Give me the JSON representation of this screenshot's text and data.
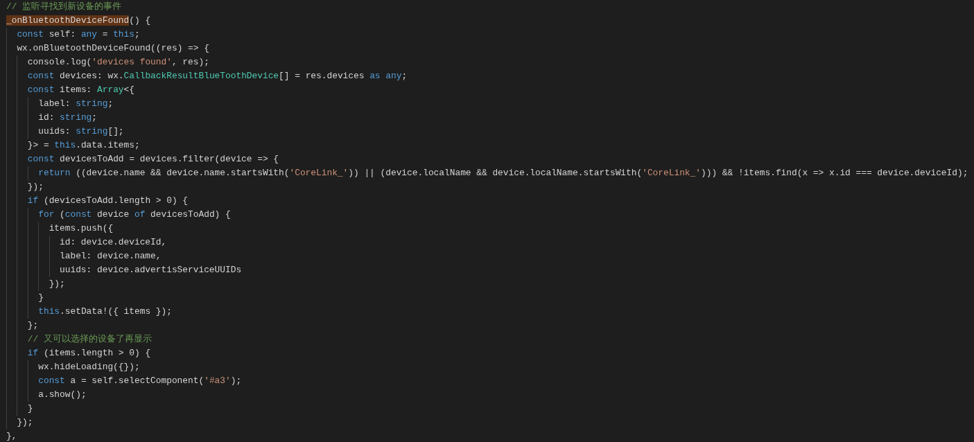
{
  "editor": {
    "lines": [
      {
        "tokens": [
          {
            "text": "// 监听寻找到新设备的事件",
            "kind": "comment"
          }
        ]
      },
      {
        "tokens": [
          {
            "text": "_onBluetoothDeviceFound",
            "kind": "plain",
            "highlighted": true
          },
          {
            "text": "() {",
            "kind": "plain"
          }
        ]
      },
      {
        "tokens": [
          {
            "text": "  const",
            "kind": "keyword"
          },
          {
            "text": " self: ",
            "kind": "plain"
          },
          {
            "text": "any",
            "kind": "keyword"
          },
          {
            "text": " = ",
            "kind": "plain"
          },
          {
            "text": "this",
            "kind": "keyword"
          },
          {
            "text": ";",
            "kind": "plain"
          }
        ]
      },
      {
        "tokens": [
          {
            "text": "  wx.onBluetoothDeviceFound((res) => {",
            "kind": "plain"
          }
        ]
      },
      {
        "tokens": [
          {
            "text": "    console.log(",
            "kind": "plain"
          },
          {
            "text": "'devices found'",
            "kind": "string"
          },
          {
            "text": ", res);",
            "kind": "plain"
          }
        ]
      },
      {
        "tokens": [
          {
            "text": "    const",
            "kind": "keyword"
          },
          {
            "text": " devices: wx.",
            "kind": "plain"
          },
          {
            "text": "CallbackResultBlueToothDevice",
            "kind": "type"
          },
          {
            "text": "[] = res.devices ",
            "kind": "plain"
          },
          {
            "text": "as",
            "kind": "keyword"
          },
          {
            "text": " any",
            "kind": "keyword"
          },
          {
            "text": ";",
            "kind": "plain"
          }
        ]
      },
      {
        "tokens": [
          {
            "text": "    const",
            "kind": "keyword"
          },
          {
            "text": " items: ",
            "kind": "plain"
          },
          {
            "text": "Array",
            "kind": "type"
          },
          {
            "text": "<{",
            "kind": "plain"
          }
        ]
      },
      {
        "tokens": [
          {
            "text": "      label: ",
            "kind": "plain"
          },
          {
            "text": "string",
            "kind": "keyword"
          },
          {
            "text": ";",
            "kind": "plain"
          }
        ]
      },
      {
        "tokens": [
          {
            "text": "      id: ",
            "kind": "plain"
          },
          {
            "text": "string",
            "kind": "keyword"
          },
          {
            "text": ";",
            "kind": "plain"
          }
        ]
      },
      {
        "tokens": [
          {
            "text": "      uuids: ",
            "kind": "plain"
          },
          {
            "text": "string",
            "kind": "keyword"
          },
          {
            "text": "[];",
            "kind": "plain"
          }
        ]
      },
      {
        "tokens": [
          {
            "text": "    }> = ",
            "kind": "plain"
          },
          {
            "text": "this",
            "kind": "keyword"
          },
          {
            "text": ".data.items;",
            "kind": "plain"
          }
        ]
      },
      {
        "tokens": [
          {
            "text": "    const",
            "kind": "keyword"
          },
          {
            "text": " devicesToAdd = devices.filter(device => {",
            "kind": "plain"
          }
        ]
      },
      {
        "tokens": [
          {
            "text": "      return",
            "kind": "keyword"
          },
          {
            "text": " ((device.name && device.name.startsWith(",
            "kind": "plain"
          },
          {
            "text": "'CoreLink_'",
            "kind": "string"
          },
          {
            "text": ")) || (device.localName && device.localName.startsWith(",
            "kind": "plain"
          },
          {
            "text": "'CoreLink_'",
            "kind": "string"
          },
          {
            "text": "))) && !items.find(x => x.id === device.deviceId);",
            "kind": "plain"
          }
        ]
      },
      {
        "tokens": [
          {
            "text": "    });",
            "kind": "plain"
          }
        ]
      },
      {
        "tokens": [
          {
            "text": "    if",
            "kind": "keyword"
          },
          {
            "text": " (devicesToAdd.length > 0) {",
            "kind": "plain"
          }
        ]
      },
      {
        "tokens": [
          {
            "text": "      for",
            "kind": "keyword"
          },
          {
            "text": " (",
            "kind": "plain"
          },
          {
            "text": "const",
            "kind": "keyword"
          },
          {
            "text": " device ",
            "kind": "plain"
          },
          {
            "text": "of",
            "kind": "keyword"
          },
          {
            "text": " devicesToAdd) {",
            "kind": "plain"
          }
        ]
      },
      {
        "tokens": [
          {
            "text": "        items.push({",
            "kind": "plain"
          }
        ]
      },
      {
        "tokens": [
          {
            "text": "          id: device.deviceId,",
            "kind": "plain"
          }
        ]
      },
      {
        "tokens": [
          {
            "text": "          label: device.name,",
            "kind": "plain"
          }
        ]
      },
      {
        "tokens": [
          {
            "text": "          uuids: device.advertisServiceUUIDs",
            "kind": "plain"
          }
        ]
      },
      {
        "tokens": [
          {
            "text": "        });",
            "kind": "plain"
          }
        ]
      },
      {
        "tokens": [
          {
            "text": "      }",
            "kind": "plain"
          }
        ]
      },
      {
        "tokens": [
          {
            "text": "      this",
            "kind": "keyword"
          },
          {
            "text": ".setData!({ items });",
            "kind": "plain"
          }
        ]
      },
      {
        "tokens": [
          {
            "text": "    };",
            "kind": "plain"
          }
        ]
      },
      {
        "tokens": [
          {
            "text": "    // 又可以选择的设备了再显示",
            "kind": "comment"
          }
        ]
      },
      {
        "tokens": [
          {
            "text": "    if",
            "kind": "keyword"
          },
          {
            "text": " (items.length > 0) {",
            "kind": "plain"
          }
        ]
      },
      {
        "tokens": [
          {
            "text": "      wx.hideLoading({});",
            "kind": "plain"
          }
        ]
      },
      {
        "tokens": [
          {
            "text": "      const",
            "kind": "keyword"
          },
          {
            "text": " a = self.selectComponent(",
            "kind": "plain"
          },
          {
            "text": "'#a3'",
            "kind": "string"
          },
          {
            "text": ");",
            "kind": "plain"
          }
        ]
      },
      {
        "tokens": [
          {
            "text": "      a.show();",
            "kind": "plain"
          }
        ]
      },
      {
        "tokens": [
          {
            "text": "    }",
            "kind": "plain"
          }
        ]
      },
      {
        "tokens": [
          {
            "text": "  });",
            "kind": "plain"
          }
        ]
      },
      {
        "tokens": [
          {
            "text": "},",
            "kind": "plain"
          }
        ]
      }
    ]
  }
}
